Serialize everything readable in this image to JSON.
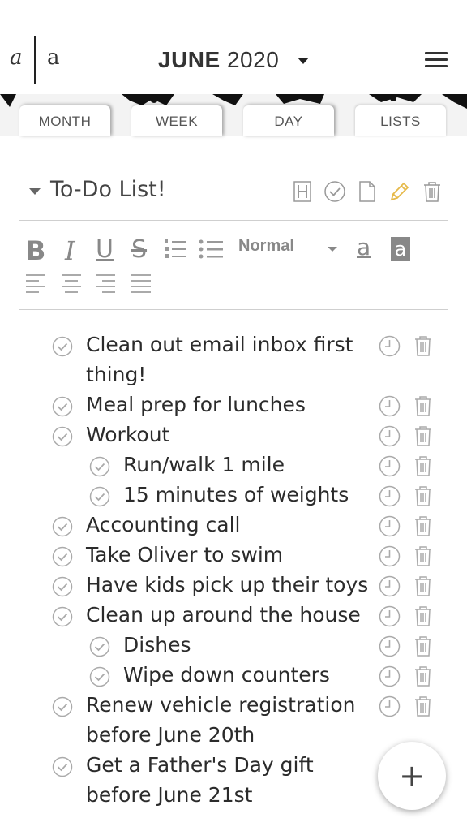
{
  "header": {
    "logo_left": "a",
    "logo_right": "a",
    "month": "JUNE",
    "year": "2020"
  },
  "tabs": [
    {
      "label": "MONTH",
      "active": false
    },
    {
      "label": "WEEK",
      "active": false
    },
    {
      "label": "DAY",
      "active": false
    },
    {
      "label": "LISTS",
      "active": true
    }
  ],
  "list": {
    "title": "To-Do List!",
    "header_icons": [
      "heading-icon",
      "check-circle-icon",
      "document-icon",
      "pencil-icon",
      "trash-icon"
    ],
    "accent_color": "#e6b94a"
  },
  "toolbar": {
    "bold": "B",
    "italic": "I",
    "underline": "U",
    "strike": "S",
    "style_value": "Normal",
    "text_color": "a",
    "bg_color": "a"
  },
  "items": [
    {
      "text_lines": [
        "Clean out email inbox first",
        "thing!"
      ],
      "indent": 0
    },
    {
      "text_lines": [
        "Meal prep for lunches"
      ],
      "indent": 0
    },
    {
      "text_lines": [
        "Workout"
      ],
      "indent": 0
    },
    {
      "text_lines": [
        "Run/walk 1 mile"
      ],
      "indent": 1
    },
    {
      "text_lines": [
        "15 minutes of weights"
      ],
      "indent": 1
    },
    {
      "text_lines": [
        "Accounting call"
      ],
      "indent": 0
    },
    {
      "text_lines": [
        "Take Oliver to swim"
      ],
      "indent": 0
    },
    {
      "text_lines": [
        "Have kids pick up their toys"
      ],
      "indent": 0
    },
    {
      "text_lines": [
        "Clean up around the house"
      ],
      "indent": 0
    },
    {
      "text_lines": [
        "Dishes"
      ],
      "indent": 1
    },
    {
      "text_lines": [
        "Wipe down counters"
      ],
      "indent": 1
    },
    {
      "text_lines": [
        "Renew vehicle registration",
        "before June 20th"
      ],
      "indent": 0
    },
    {
      "text_lines": [
        "Get a Father's Day gift",
        "before June 21st"
      ],
      "indent": 0
    }
  ],
  "fab": {
    "label": "+"
  }
}
